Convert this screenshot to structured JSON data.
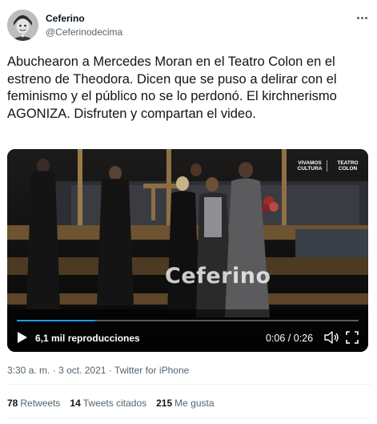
{
  "author": {
    "display_name": "Ceferino",
    "handle": "@Ceferinodecima"
  },
  "tweet": {
    "text": "Abuchearon a Mercedes Moran en el Teatro Colon en el estreno de Theodora. Dicen que se puso a delirar con el feminismo y el público no se lo perdonó. El kirchnerismo AGONIZA. Disfruten y compartan el video."
  },
  "video": {
    "watermark": "Ceferino",
    "logo_left": "VIVAMOS CULTURA",
    "logo_right": "TEATRO COLON",
    "views": "6,1 mil reproducciones",
    "time": "0:06 / 0:26",
    "progress": 0.23
  },
  "meta": {
    "time": "3:30 a. m.",
    "separator": "·",
    "date": "3 oct. 2021",
    "source": "Twitter for iPhone"
  },
  "stats": {
    "retweets_count": "78",
    "retweets_label": "Retweets",
    "quotes_count": "14",
    "quotes_label": "Tweets citados",
    "likes_count": "215",
    "likes_label": "Me gusta"
  },
  "colors": {
    "text": "#0f1419",
    "secondary": "#536471",
    "divider": "#eff3f4"
  },
  "icons": [
    "more-icon",
    "play-icon",
    "volume-icon",
    "fullscreen-icon"
  ]
}
